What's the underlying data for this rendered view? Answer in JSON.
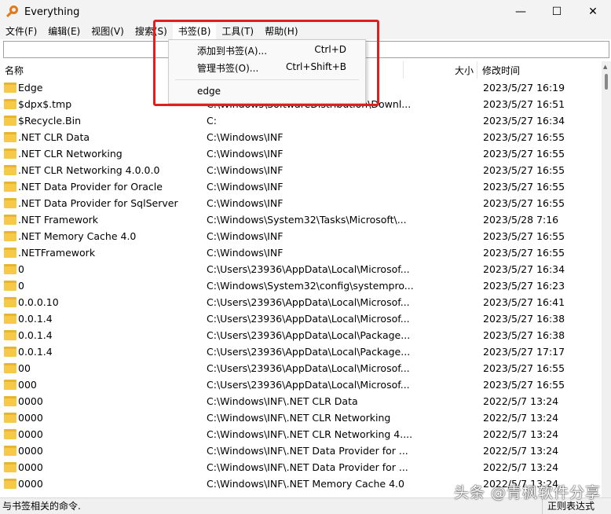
{
  "window": {
    "title": "Everything",
    "minimize": "—",
    "maximize": "☐",
    "close": "✕"
  },
  "menu": [
    "文件(F)",
    "编辑(E)",
    "视图(V)",
    "搜索(S)",
    "书签(B)",
    "工具(T)",
    "帮助(H)"
  ],
  "search": {
    "value": "",
    "placeholder": ""
  },
  "columns": {
    "name": "名称",
    "size": "大小",
    "modified": "修改时间"
  },
  "rows": [
    {
      "name": "Edge",
      "path": "",
      "date": "2023/5/27 16:19"
    },
    {
      "name": "$dpx$.tmp",
      "path": "C:\\Windows\\SoftwareDistribution\\Downl...",
      "date": "2023/5/27 16:51"
    },
    {
      "name": "$Recycle.Bin",
      "path": "C:",
      "date": "2023/5/27 16:34"
    },
    {
      "name": ".NET CLR Data",
      "path": "C:\\Windows\\INF",
      "date": "2023/5/27 16:55"
    },
    {
      "name": ".NET CLR Networking",
      "path": "C:\\Windows\\INF",
      "date": "2023/5/27 16:55"
    },
    {
      "name": ".NET CLR Networking 4.0.0.0",
      "path": "C:\\Windows\\INF",
      "date": "2023/5/27 16:55"
    },
    {
      "name": ".NET Data Provider for Oracle",
      "path": "C:\\Windows\\INF",
      "date": "2023/5/27 16:55"
    },
    {
      "name": ".NET Data Provider for SqlServer",
      "path": "C:\\Windows\\INF",
      "date": "2023/5/27 16:55"
    },
    {
      "name": ".NET Framework",
      "path": "C:\\Windows\\System32\\Tasks\\Microsoft\\...",
      "date": "2023/5/28 7:16"
    },
    {
      "name": ".NET Memory Cache 4.0",
      "path": "C:\\Windows\\INF",
      "date": "2023/5/27 16:55"
    },
    {
      "name": ".NETFramework",
      "path": "C:\\Windows\\INF",
      "date": "2023/5/27 16:55"
    },
    {
      "name": "0",
      "path": "C:\\Users\\23936\\AppData\\Local\\Microsof...",
      "date": "2023/5/27 16:34"
    },
    {
      "name": "0",
      "path": "C:\\Windows\\System32\\config\\systempro...",
      "date": "2023/5/27 16:23"
    },
    {
      "name": "0.0.0.10",
      "path": "C:\\Users\\23936\\AppData\\Local\\Microsof...",
      "date": "2023/5/27 16:41"
    },
    {
      "name": "0.0.1.4",
      "path": "C:\\Users\\23936\\AppData\\Local\\Microsof...",
      "date": "2023/5/27 16:38"
    },
    {
      "name": "0.0.1.4",
      "path": "C:\\Users\\23936\\AppData\\Local\\Package...",
      "date": "2023/5/27 16:38"
    },
    {
      "name": "0.0.1.4",
      "path": "C:\\Users\\23936\\AppData\\Local\\Package...",
      "date": "2023/5/27 17:17"
    },
    {
      "name": "00",
      "path": "C:\\Users\\23936\\AppData\\Local\\Microsof...",
      "date": "2023/5/27 16:55"
    },
    {
      "name": "000",
      "path": "C:\\Users\\23936\\AppData\\Local\\Microsof...",
      "date": "2023/5/27 16:55"
    },
    {
      "name": "0000",
      "path": "C:\\Windows\\INF\\.NET CLR Data",
      "date": "2022/5/7 13:24"
    },
    {
      "name": "0000",
      "path": "C:\\Windows\\INF\\.NET CLR Networking",
      "date": "2022/5/7 13:24"
    },
    {
      "name": "0000",
      "path": "C:\\Windows\\INF\\.NET CLR Networking 4....",
      "date": "2022/5/7 13:24"
    },
    {
      "name": "0000",
      "path": "C:\\Windows\\INF\\.NET Data Provider for ...",
      "date": "2022/5/7 13:24"
    },
    {
      "name": "0000",
      "path": "C:\\Windows\\INF\\.NET Data Provider for ...",
      "date": "2022/5/7 13:24"
    },
    {
      "name": "0000",
      "path": "C:\\Windows\\INF\\.NET Memory Cache 4.0",
      "date": "2022/5/7 13:24"
    }
  ],
  "bookmarks_menu": {
    "add": {
      "label": "添加到书签(A)...",
      "shortcut": "Ctrl+D"
    },
    "manage": {
      "label": "管理书签(O)...",
      "shortcut": "Ctrl+Shift+B"
    },
    "items": [
      "edge"
    ]
  },
  "status": {
    "left": "与书签相关的命令.",
    "right": "正则表达式"
  },
  "watermark": "头条 @青枫软件分享"
}
